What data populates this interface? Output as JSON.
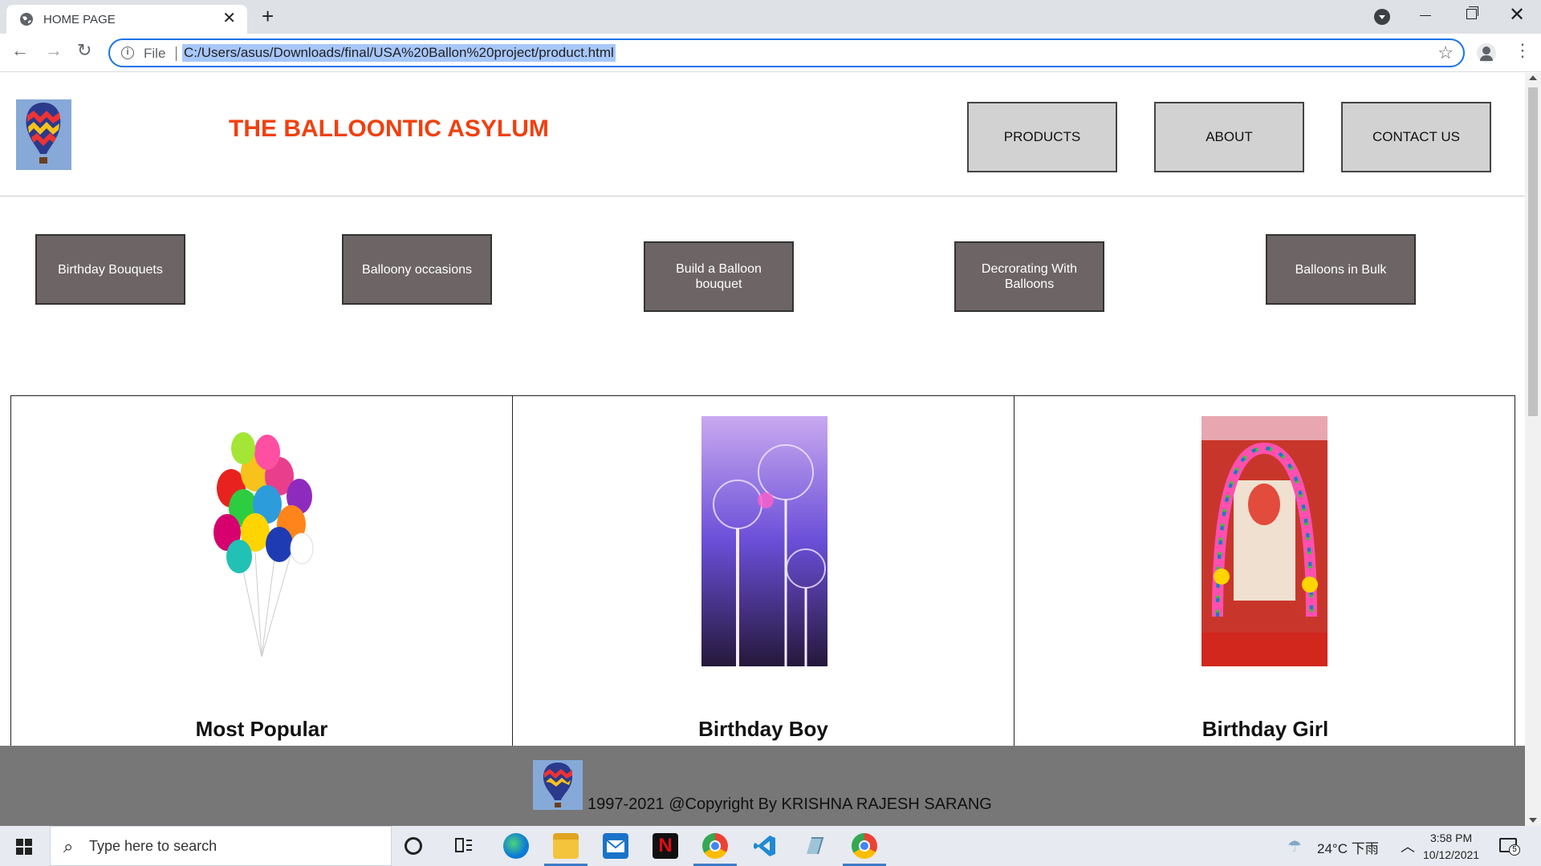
{
  "browser": {
    "tab_title": "HOME PAGE",
    "new_tab": "+",
    "close": "✕",
    "url_scheme": "File",
    "url": "C:/Users/asus/Downloads/final/USA%20Ballon%20project/product.html"
  },
  "site": {
    "title": "THE BALLOONTIC ASYLUM",
    "nav": [
      "PRODUCTS",
      "ABOUT",
      "CONTACT US"
    ],
    "categories": [
      "Birthday Bouquets",
      "Balloony occasions",
      "Build a Balloon bouquet",
      "Decrorating With Balloons",
      "Balloons in Bulk"
    ],
    "products": [
      "Most Popular",
      "Birthday Boy",
      "Birthday Girl"
    ],
    "footer_text": "1997-2021 @Copyright By KRISHNA RAJESH SARANG"
  },
  "taskbar": {
    "search_placeholder": "Type here to search",
    "weather": "24°C  下雨",
    "time": "3:58 PM",
    "date": "10/12/2021",
    "notification_count": "5"
  },
  "colors": {
    "title": "#f04010",
    "nav_box": "#d2d2d2",
    "category_button": "#6d6565",
    "footer": "#777777",
    "focus": "#1a73e8"
  }
}
